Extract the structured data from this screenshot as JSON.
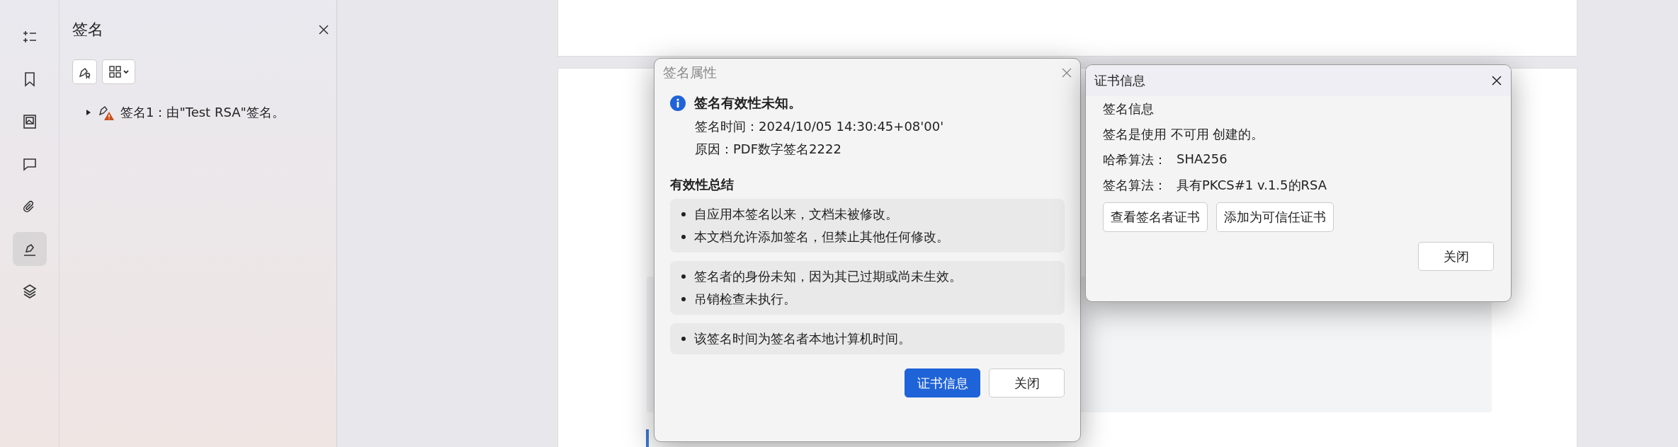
{
  "rail": {
    "items": [
      {
        "kind": "outline",
        "selected": false
      },
      {
        "kind": "bookmark",
        "selected": false
      },
      {
        "kind": "image",
        "selected": false
      },
      {
        "kind": "comment",
        "selected": false
      },
      {
        "kind": "attachment",
        "selected": false
      },
      {
        "kind": "signature",
        "selected": true
      },
      {
        "kind": "layers",
        "selected": false
      }
    ]
  },
  "panel": {
    "title": "签名",
    "tree": [
      {
        "label": "签名1：由\"Test RSA\"签名。",
        "expanded": false,
        "warning": true
      }
    ]
  },
  "signature_properties": {
    "title": "签名属性",
    "status": "签名有效性未知。",
    "details": [
      "签名时间：2024/10/05 14:30:45+08'00'",
      "原因：PDF数字签名2222"
    ],
    "summary_heading": "有效性总结",
    "groups": [
      [
        "自应用本签名以来，文档未被修改。",
        "本文档允许添加签名，但禁止其他任何修改。"
      ],
      [
        "签名者的身份未知，因为其已过期或尚未生效。",
        "吊销检查未执行。"
      ],
      [
        "该签名时间为签名者本地计算机时间。"
      ]
    ],
    "buttons": [
      {
        "label": "证书信息",
        "primary": true
      },
      {
        "label": "关闭",
        "primary": false
      }
    ]
  },
  "certificate_info": {
    "title": "证书信息",
    "heading": "签名信息",
    "lines": [
      {
        "label": "签名是使用 不可用 创建的。"
      },
      {
        "label": "哈希算法：",
        "value": "SHA256"
      },
      {
        "label": "签名算法：",
        "value": "具有PKCS#1 v.1.5的RSA"
      }
    ],
    "actions": [
      "查看签名者证书",
      "添加为可信任证书"
    ],
    "close": "关闭"
  }
}
